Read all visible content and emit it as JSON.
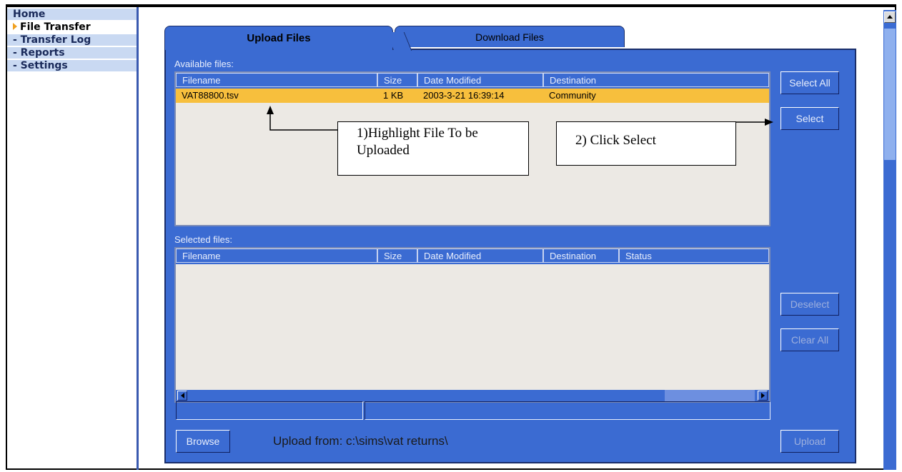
{
  "nav": {
    "items": [
      {
        "label": "Home",
        "active": false
      },
      {
        "label": "File Transfer",
        "active": true
      },
      {
        "label": "- Transfer Log",
        "active": false
      },
      {
        "label": "- Reports",
        "active": false
      },
      {
        "label": "- Settings",
        "active": false
      }
    ]
  },
  "tabs": [
    {
      "label": "Upload Files",
      "selected": true
    },
    {
      "label": "Download Files",
      "selected": false
    }
  ],
  "available": {
    "label": "Available files:",
    "columns": [
      "Filename",
      "Size",
      "Date Modified",
      "Destination"
    ],
    "rows": [
      {
        "filename": "VAT88800.tsv",
        "size": "1 KB",
        "date_modified": "2003-3-21 16:39:14",
        "destination": "Community"
      }
    ]
  },
  "selected": {
    "label": "Selected files:",
    "columns": [
      "Filename",
      "Size",
      "Date Modified",
      "Destination",
      "Status"
    ]
  },
  "buttons": {
    "select_all": "Select All",
    "select": "Select",
    "deselect": "Deselect",
    "clear_all": "Clear All",
    "browse": "Browse",
    "upload": "Upload"
  },
  "upload_from": "Upload from: c:\\sims\\vat returns\\",
  "annotations": {
    "highlight": "1)Highlight File To be Uploaded",
    "click_select": "2) Click Select"
  },
  "colors": {
    "panel_blue": "#3b6bd2",
    "highlight_orange": "#f7bf3d",
    "nav_bg": "#c9d9f2"
  }
}
